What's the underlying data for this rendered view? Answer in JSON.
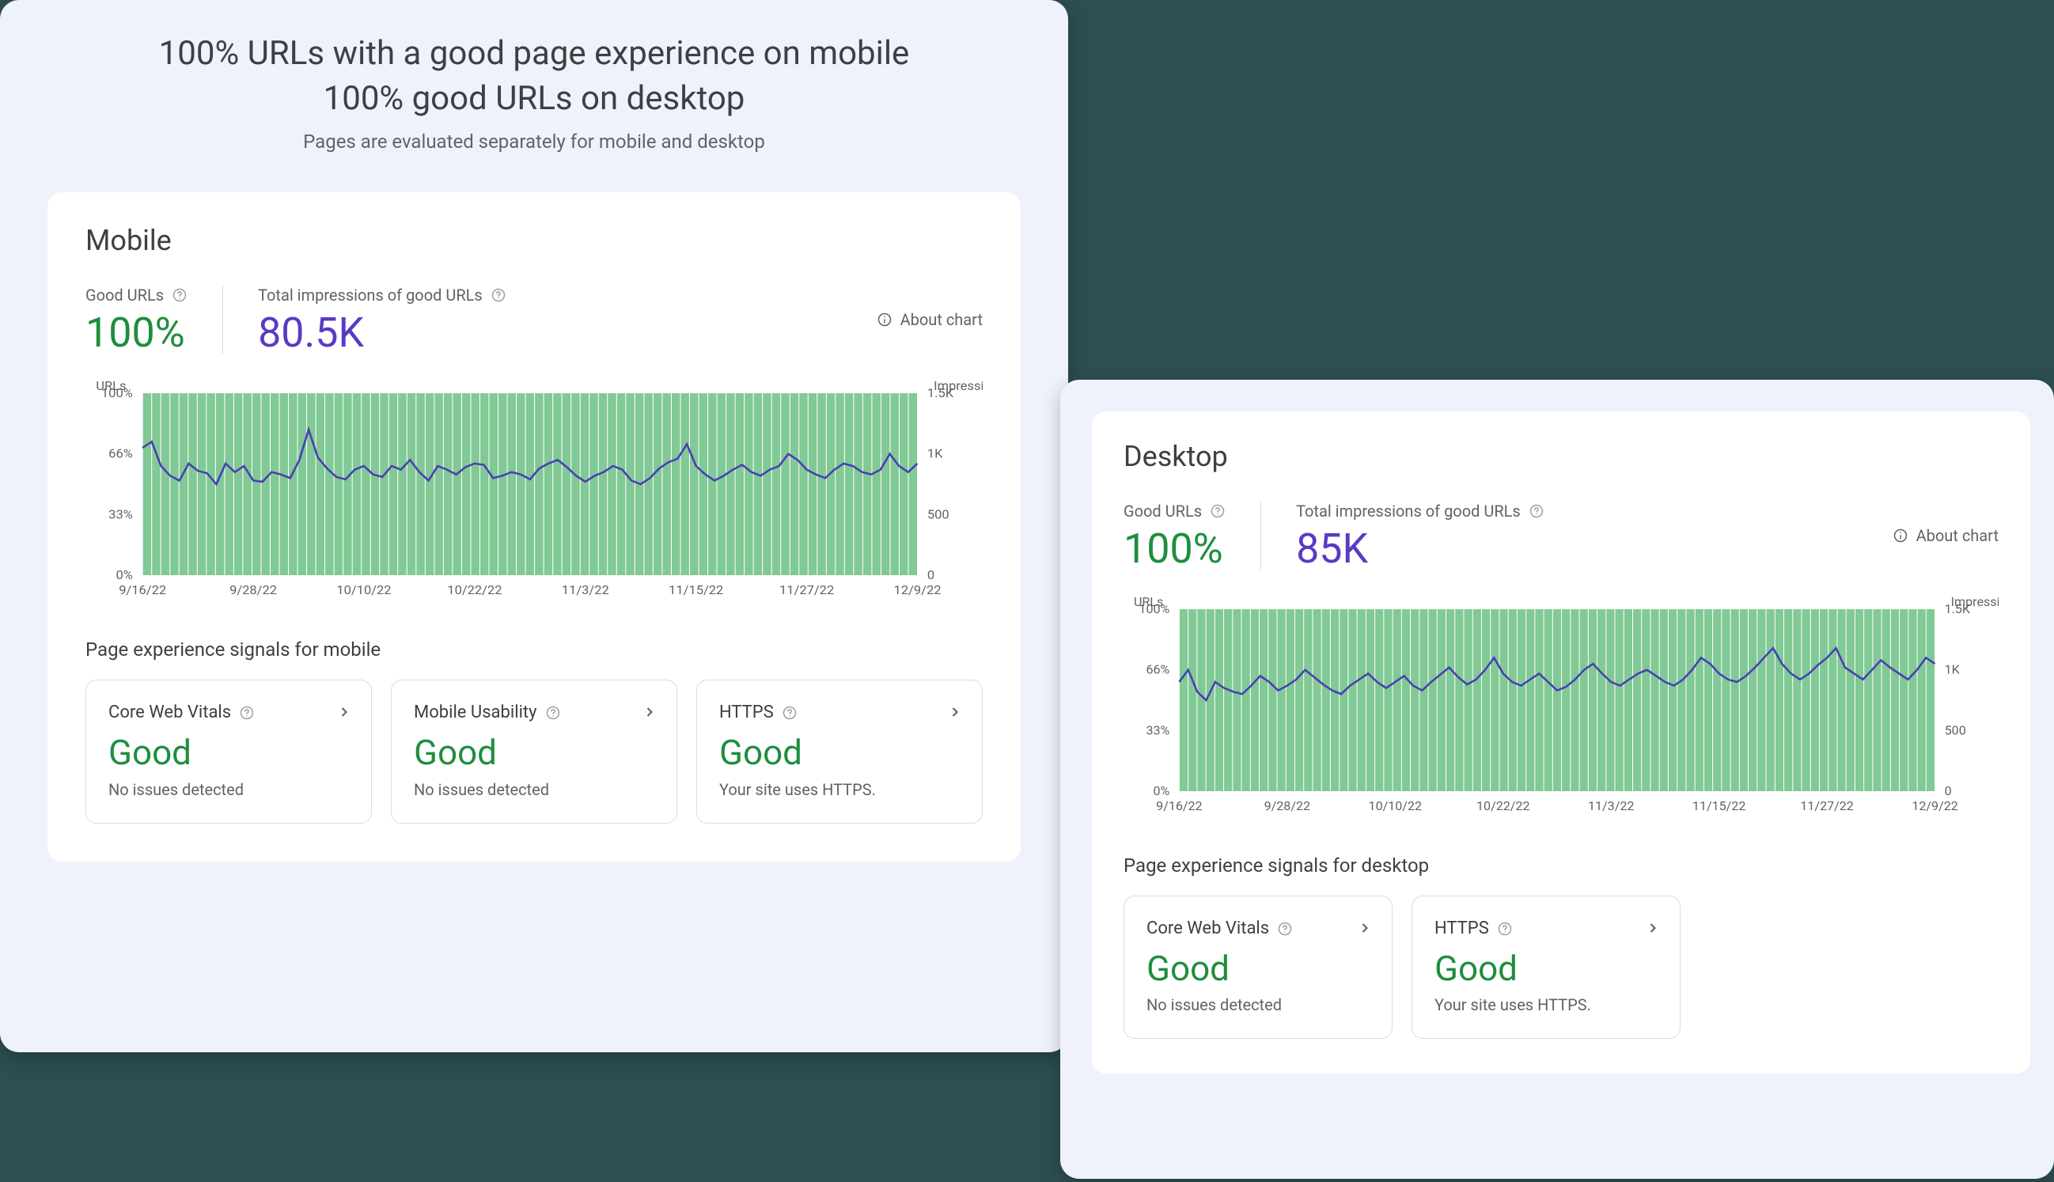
{
  "header": {
    "line1": "100% URLs with a good page experience on mobile",
    "line2": "100% good URLs on desktop",
    "sub": "Pages are evaluated separately for mobile and desktop"
  },
  "mobile": {
    "title": "Mobile",
    "good_urls_label": "Good URLs",
    "good_urls_value": "100%",
    "impressions_label": "Total impressions of good URLs",
    "impressions_value": "80.5K",
    "about_chart": "About chart",
    "signals_title": "Page experience signals for mobile",
    "signals": [
      {
        "title": "Core Web Vitals",
        "value": "Good",
        "desc": "No issues detected"
      },
      {
        "title": "Mobile Usability",
        "value": "Good",
        "desc": "No issues detected"
      },
      {
        "title": "HTTPS",
        "value": "Good",
        "desc": "Your site uses HTTPS."
      }
    ]
  },
  "desktop": {
    "title": "Desktop",
    "good_urls_label": "Good URLs",
    "good_urls_value": "100%",
    "impressions_label": "Total impressions of good URLs",
    "impressions_value": "85K",
    "about_chart": "About chart",
    "signals_title": "Page experience signals for desktop",
    "signals": [
      {
        "title": "Core Web Vitals",
        "value": "Good",
        "desc": "No issues detected"
      },
      {
        "title": "HTTPS",
        "value": "Good",
        "desc": "Your site uses HTTPS."
      }
    ]
  },
  "chart_data": [
    {
      "panel": "mobile",
      "type": "bar+line",
      "left_axis": {
        "label": "URLs",
        "ticks": [
          "0%",
          "33%",
          "66%",
          "100%"
        ],
        "range": [
          0,
          100
        ]
      },
      "right_axis": {
        "label": "Impressions",
        "ticks": [
          "0",
          "500",
          "1K",
          "1.5K"
        ],
        "range": [
          0,
          1500
        ]
      },
      "categories": [
        "9/16/22",
        "9/28/22",
        "10/10/22",
        "10/22/22",
        "11/3/22",
        "11/15/22",
        "11/27/22",
        "12/9/22"
      ],
      "series": [
        {
          "name": "Good URLs %",
          "kind": "bar",
          "color": "#81c995",
          "values_pct_constant": 100,
          "days": 85
        },
        {
          "name": "Impressions",
          "kind": "line",
          "color": "#4a3db3",
          "values": [
            1050,
            1100,
            900,
            820,
            780,
            920,
            860,
            840,
            750,
            920,
            850,
            900,
            780,
            770,
            850,
            830,
            800,
            950,
            1200,
            970,
            880,
            810,
            790,
            870,
            900,
            830,
            810,
            900,
            870,
            950,
            850,
            780,
            900,
            870,
            830,
            890,
            920,
            910,
            800,
            820,
            850,
            830,
            790,
            880,
            920,
            950,
            890,
            820,
            770,
            820,
            850,
            900,
            870,
            780,
            750,
            800,
            880,
            930,
            960,
            1080,
            900,
            830,
            780,
            820,
            870,
            910,
            850,
            820,
            870,
            900,
            1000,
            950,
            870,
            830,
            800,
            870,
            920,
            900,
            850,
            830,
            870,
            1000,
            900,
            850,
            920
          ]
        }
      ]
    },
    {
      "panel": "desktop",
      "type": "bar+line",
      "left_axis": {
        "label": "URLs",
        "ticks": [
          "0%",
          "33%",
          "66%",
          "100%"
        ],
        "range": [
          0,
          100
        ]
      },
      "right_axis": {
        "label": "Impressions",
        "ticks": [
          "0",
          "500",
          "1K",
          "1.5K"
        ],
        "range": [
          0,
          1500
        ]
      },
      "categories": [
        "9/16/22",
        "9/28/22",
        "10/10/22",
        "10/22/22",
        "11/3/22",
        "11/15/22",
        "11/27/22",
        "12/9/22"
      ],
      "series": [
        {
          "name": "Good URLs %",
          "kind": "bar",
          "color": "#81c995",
          "values_pct_constant": 100,
          "days": 85
        },
        {
          "name": "Impressions",
          "kind": "line",
          "color": "#4a3db3",
          "values": [
            900,
            1000,
            820,
            750,
            900,
            850,
            820,
            800,
            870,
            950,
            900,
            830,
            870,
            920,
            1000,
            940,
            880,
            830,
            800,
            870,
            920,
            970,
            900,
            850,
            900,
            950,
            870,
            830,
            900,
            960,
            1020,
            940,
            880,
            920,
            1000,
            1100,
            970,
            900,
            870,
            920,
            970,
            900,
            830,
            860,
            920,
            1000,
            1050,
            970,
            900,
            870,
            920,
            970,
            1000,
            950,
            900,
            870,
            920,
            1000,
            1100,
            1050,
            970,
            920,
            900,
            950,
            1020,
            1100,
            1180,
            1050,
            970,
            920,
            970,
            1040,
            1100,
            1180,
            1020,
            970,
            920,
            1000,
            1080,
            1020,
            970,
            920,
            1000,
            1100,
            1050
          ]
        }
      ]
    }
  ]
}
